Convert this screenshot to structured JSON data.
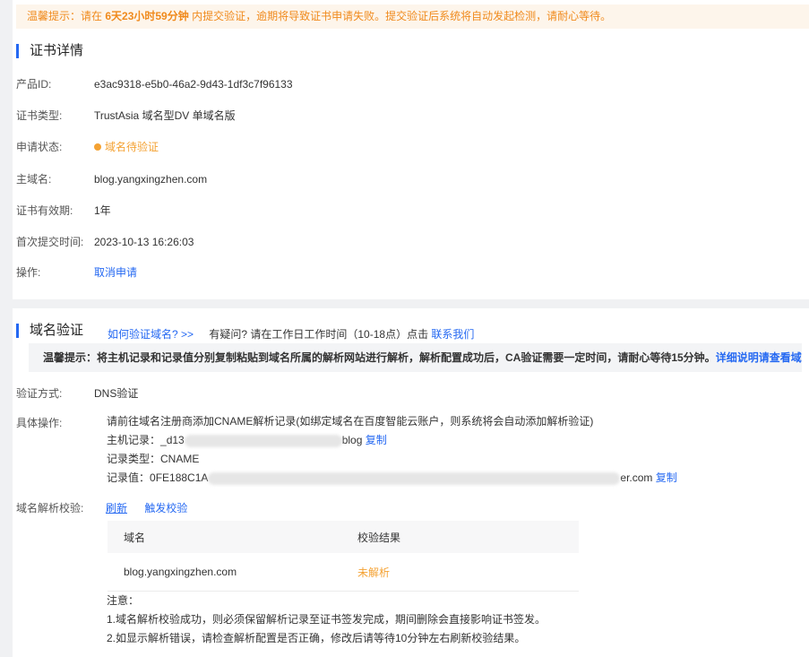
{
  "banner": {
    "prefix": "温馨提示：请在",
    "time": "6天23小时59分钟",
    "suffix": "内提交验证，逾期将导致证书申请失败。提交验证后系统将自动发起检测，请耐心等待。"
  },
  "details": {
    "title": "证书详情",
    "rows": [
      {
        "label": "产品ID:",
        "value": "e3ac9318-e5b0-46a2-9d43-1df3c7f96133"
      },
      {
        "label": "证书类型:",
        "value": "TrustAsia 域名型DV 单域名版"
      },
      {
        "label": "申请状态:",
        "value": "域名待验证"
      },
      {
        "label": "主域名:",
        "value": "blog.yangxingzhen.com"
      },
      {
        "label": "证书有效期:",
        "value": "1年"
      },
      {
        "label": "首次提交时间:",
        "value": "2023-10-13 16:26:03"
      },
      {
        "label": "操作:",
        "value": "取消申请"
      }
    ]
  },
  "verify": {
    "title": "域名验证",
    "how_link": "如何验证域名? >>",
    "question": "有疑问? 请在工作日工作时间（10-18点）点击",
    "contact_link": "联系我们",
    "tip_text": "温馨提示：将主机记录和记录值分别复制粘贴到域名所属的解析网站进行解析，解析配置成功后，CA验证需要一定时间，请耐心等待15分钟。",
    "tip_link": "详细说明请查看域名验证流程介绍>>",
    "method_label": "验证方式:",
    "method_value": "DNS验证",
    "ops_label": "具体操作:",
    "ops_intro": "请前往域名注册商添加CNAME解析记录(如绑定域名在百度智能云账户，则系统将会自动添加解析验证)",
    "host_label": "主机记录：",
    "host_prefix": "_d13",
    "host_suffix": "blog",
    "copy": "复制",
    "type_label": "记录类型：",
    "type_value": "CNAME",
    "value_label": "记录值：",
    "value_prefix": "0FE188C1A",
    "value_suffix": "er.com",
    "check_label": "域名解析校验:",
    "refresh": "刷新",
    "trigger": "触发校验",
    "table": {
      "headers": [
        "域名",
        "校验结果"
      ],
      "rows": [
        {
          "domain": "blog.yangxingzhen.com",
          "result": "未解析"
        }
      ]
    },
    "note_title": "注意：",
    "note1": "1.域名解析校验成功，则必须保留解析记录至证书签发完成，期间删除会直接影响证书签发。",
    "note2": "2.如显示解析错误，请检查解析配置是否正确，修改后请等待10分钟左右刷新校验结果。"
  },
  "colors": {
    "accent": "#2468f2",
    "warning": "#f4a233",
    "banner_text": "#f08a1c"
  }
}
